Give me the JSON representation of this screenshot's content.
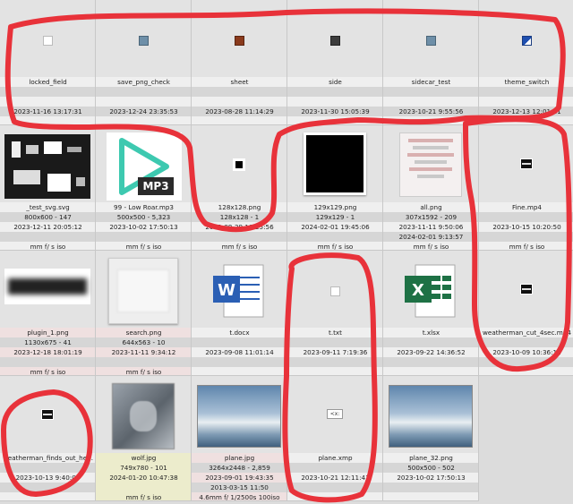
{
  "colors": {
    "annotation": "#e8323a",
    "word": "#2b5fb4",
    "excel": "#1e7145",
    "mp3": "#3dc9b0",
    "tag": "#2b66c4"
  },
  "cells": [
    {
      "name": "locked_field",
      "icon": "white-square-icon",
      "lines": [
        "locked_field",
        "",
        "",
        "2023-11-16 13:17:31",
        "",
        ""
      ],
      "bands": [
        "w",
        "g",
        "w",
        "g",
        "w",
        "g"
      ]
    },
    {
      "name": "save_png_check",
      "icon": "blue-square-icon",
      "lines": [
        "save_png_check",
        "",
        "",
        "2023-12-24 23:35:53",
        "",
        ""
      ],
      "bands": [
        "w",
        "g",
        "w",
        "g",
        "w",
        "g"
      ]
    },
    {
      "name": "sheet",
      "icon": "brown-square-icon",
      "lines": [
        "sheet",
        "",
        "",
        "2023-08-28 11:14:29",
        "",
        ""
      ],
      "bands": [
        "w",
        "g",
        "w",
        "g",
        "w",
        "g"
      ]
    },
    {
      "name": "side",
      "icon": "dark-square-icon",
      "lines": [
        "side",
        "",
        "",
        "2023-11-30 15:05:39",
        "",
        ""
      ],
      "bands": [
        "w",
        "g",
        "w",
        "g",
        "w",
        "g"
      ]
    },
    {
      "name": "sidecar_test",
      "icon": "blue-square-icon",
      "lines": [
        "sidecar_test",
        "",
        "",
        "2023-10-21 9:55:56",
        "",
        ""
      ],
      "bands": [
        "w",
        "g",
        "w",
        "g",
        "w",
        "g"
      ]
    },
    {
      "name": "theme_switch",
      "icon": "blue-white-square-icon",
      "lines": [
        "theme_switch",
        "",
        "",
        "2023-12-13 12:01:11",
        "",
        ""
      ],
      "bands": [
        "w",
        "g",
        "w",
        "g",
        "w",
        "g"
      ]
    },
    {
      "name": "_test_svg.svg",
      "icon": "svg-thumbnail-icon",
      "lines": [
        "_test_svg.svg",
        "800x600 - 147",
        "2023-12-11 20:05:12",
        "",
        "mm f/ s iso",
        ""
      ],
      "bands": [
        "w",
        "g",
        "w",
        "g",
        "w",
        "g"
      ]
    },
    {
      "name": "99 - Low Roar.mp3",
      "icon": "mp3-play-icon",
      "lines": [
        "99 - Low Roar.mp3",
        "500x500 - 5,323",
        "2023-10-02 17:50:13",
        "",
        "mm f/ s iso",
        ""
      ],
      "bands": [
        "w",
        "g",
        "w",
        "g",
        "w",
        "g"
      ]
    },
    {
      "name": "128x128.png",
      "icon": "black-square-icon",
      "lines": [
        "128x128.png",
        "128x128 - 1",
        "2023-08-29 18:25:56",
        "",
        "mm f/ s iso",
        ""
      ],
      "bands": [
        "w",
        "g",
        "w",
        "g",
        "w",
        "g"
      ]
    },
    {
      "name": "129x129.png",
      "icon": "black-image-icon",
      "lines": [
        "129x129.png",
        "129x129 - 1",
        "2024-02-01 19:45:06",
        "",
        "mm f/ s iso",
        ""
      ],
      "bands": [
        "w",
        "g",
        "w",
        "g",
        "w",
        "g"
      ]
    },
    {
      "name": "all.png",
      "icon": "list-image-icon",
      "lines": [
        "all.png",
        "307x1592 - 209",
        "2023-11-11 9:50:06",
        "2024-02-01 9:13:57",
        "mm f/ s iso",
        ""
      ],
      "bands": [
        "w",
        "g",
        "w",
        "g",
        "w",
        "g"
      ]
    },
    {
      "name": "Fine.mp4",
      "icon": "video-icon",
      "lines": [
        "Fine.mp4",
        "",
        "2023-10-15 10:20:50",
        "",
        "mm f/ s iso",
        ""
      ],
      "bands": [
        "w",
        "g",
        "w",
        "g",
        "w",
        "g"
      ]
    },
    {
      "name": "plugin_1.png",
      "icon": "blurred-bar-icon",
      "lines": [
        "plugin_1.png",
        "1130x675 - 41",
        "2023-12-18 18:01:19",
        "",
        "mm f/ s iso",
        ""
      ],
      "bands": [
        "pk",
        "g",
        "pk",
        "g",
        "pk",
        "g"
      ]
    },
    {
      "name": "search.png",
      "icon": "light-image-icon",
      "lines": [
        "search.png",
        "644x563 - 10",
        "2023-11-11 9:34:12",
        "",
        "mm f/ s iso",
        ""
      ],
      "bands": [
        "pk",
        "g",
        "pk",
        "g",
        "pk",
        "g"
      ]
    },
    {
      "name": "t.docx",
      "icon": "word-document-icon",
      "lines": [
        "t.docx",
        "",
        "2023-09-08 11:01:14",
        "",
        "",
        ""
      ],
      "bands": [
        "w",
        "g",
        "w",
        "g",
        "w",
        "g"
      ]
    },
    {
      "name": "t.txt",
      "icon": "white-square-icon",
      "lines": [
        "t.txt",
        "",
        "2023-09-11 7:19:36",
        "",
        "",
        ""
      ],
      "bands": [
        "w",
        "g",
        "w",
        "g",
        "w",
        "g"
      ]
    },
    {
      "name": "t.xlsx",
      "icon": "excel-document-icon",
      "lines": [
        "t.xlsx",
        "",
        "2023-09-22 14:36:52",
        "",
        "",
        ""
      ],
      "bands": [
        "w",
        "g",
        "w",
        "g",
        "w",
        "g"
      ]
    },
    {
      "name": "weatherman_cut_4sec.mp4",
      "icon": "video-icon",
      "lines": [
        "weatherman_cut_4sec.mp4",
        "",
        "2023-10-09 10:36:12",
        "",
        "",
        ""
      ],
      "bands": [
        "w",
        "g",
        "w",
        "g",
        "w",
        "g"
      ]
    },
    {
      "name": "weatherman_finds_out_he...",
      "icon": "video-icon",
      "lines": [
        "weatherman_finds_out_he...",
        "",
        "2023-10-13 9:40:06",
        "",
        "",
        ""
      ],
      "bands": [
        "w",
        "g",
        "w",
        "g",
        "w",
        "g"
      ]
    },
    {
      "name": "wolf.jpg",
      "icon": "wolf-photo-icon",
      "lines": [
        "wolf.jpg",
        "749x780 - 101",
        "2024-01-20 10:47:38",
        "",
        "mm f/ s iso",
        ""
      ],
      "bands": [
        "y",
        "y",
        "y",
        "y",
        "y",
        "y"
      ]
    },
    {
      "name": "plane.jpg",
      "icon": "sky-photo-icon",
      "lines": [
        "plane.jpg",
        "3264x2448 - 2,859",
        "2023-09-01 19:43:35",
        "2013-03-15 11:50",
        "4.6mm f/ 1/2500s 100iso",
        ""
      ],
      "bands": [
        "pk",
        "g",
        "pk",
        "g",
        "pk",
        "g"
      ]
    },
    {
      "name": "plane.xmp",
      "icon": "xmp-tag-icon",
      "lines": [
        "plane.xmp",
        "",
        "2023-10-21 12:11:41",
        "",
        "",
        ""
      ],
      "bands": [
        "w",
        "g",
        "w",
        "g",
        "w",
        "g"
      ]
    },
    {
      "name": "plane_32.png",
      "icon": "sky-photo-icon",
      "lines": [
        "plane_32.png",
        "500x500 - 502",
        "2023-10-02 17:50:13",
        "",
        "",
        ""
      ],
      "bands": [
        "w",
        "g",
        "w",
        "g",
        "w",
        "g"
      ]
    }
  ]
}
